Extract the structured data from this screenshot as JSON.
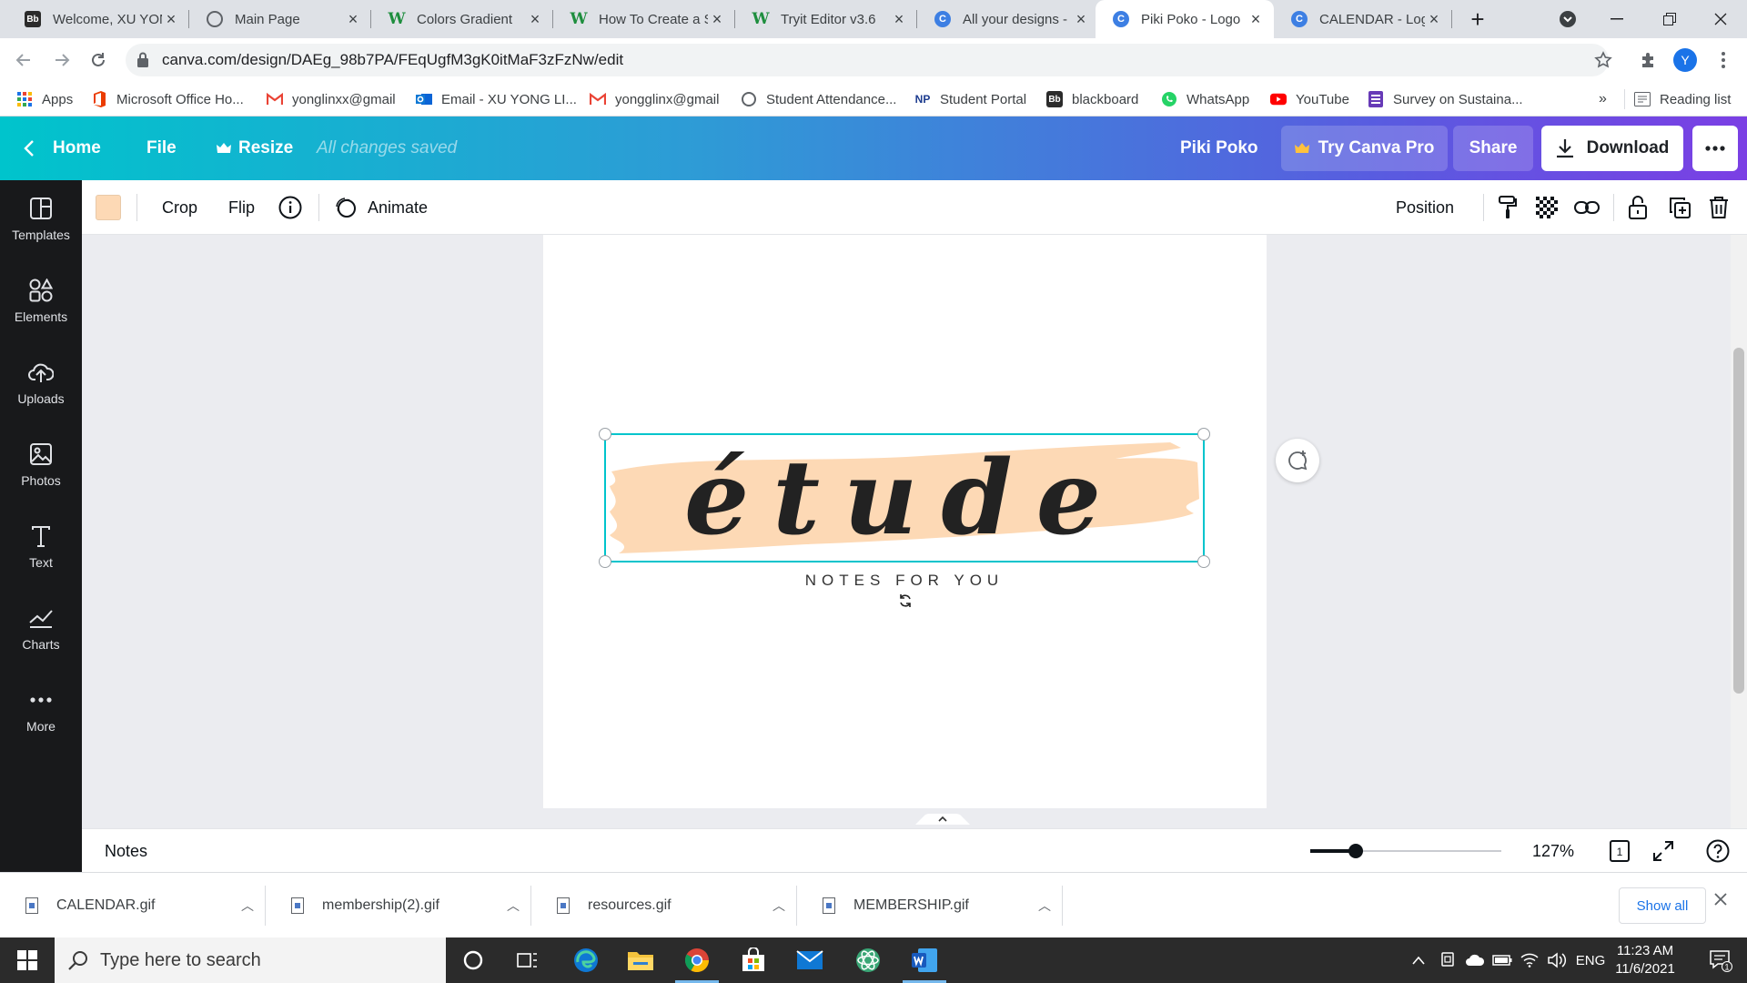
{
  "browser": {
    "tabs": [
      {
        "label": "Welcome, XU YON",
        "icon": "blackboard-icon"
      },
      {
        "label": "Main Page",
        "icon": "globe-icon"
      },
      {
        "label": "Colors Gradient",
        "icon": "w-site-icon"
      },
      {
        "label": "How To Create a S",
        "icon": "w-site-icon"
      },
      {
        "label": "Tryit Editor v3.6",
        "icon": "w-site-icon"
      },
      {
        "label": "All your designs -",
        "icon": "canva-icon"
      },
      {
        "label": "Piki Poko - Logo",
        "icon": "canva-icon",
        "active": true
      },
      {
        "label": "CALENDAR - Logo",
        "icon": "canva-icon"
      }
    ],
    "url": "canva.com/design/DAEg_98b7PA/FEqUgfM3gK0itMaF3zFzNw/edit",
    "profile_initial": "Y",
    "bookmarks": [
      {
        "label": "Apps"
      },
      {
        "label": "Microsoft Office Ho..."
      },
      {
        "label": "yonglinxx@gmail"
      },
      {
        "label": "Email - XU YONG LI..."
      },
      {
        "label": "yongglinx@gmail"
      },
      {
        "label": "Student Attendance..."
      },
      {
        "label": "Student Portal"
      },
      {
        "label": "blackboard"
      },
      {
        "label": "WhatsApp"
      },
      {
        "label": "YouTube"
      },
      {
        "label": "Survey on Sustaina..."
      }
    ],
    "bookmarks_overflow": "»",
    "reading_list": "Reading list"
  },
  "canva": {
    "header": {
      "home": "Home",
      "file": "File",
      "resize": "Resize",
      "saved_status": "All changes saved",
      "design_name": "Piki Poko",
      "try_pro": "Try Canva Pro",
      "share": "Share",
      "download": "Download"
    },
    "sidebar": [
      {
        "label": "Templates"
      },
      {
        "label": "Elements"
      },
      {
        "label": "Uploads"
      },
      {
        "label": "Photos"
      },
      {
        "label": "Text"
      },
      {
        "label": "Charts"
      },
      {
        "label": "More"
      }
    ],
    "toolbar": {
      "swatch_color": "#fdd9b5",
      "crop": "Crop",
      "flip": "Flip",
      "animate": "Animate",
      "position": "Position"
    },
    "canvas": {
      "logo_text": "étude",
      "tagline": "NOTES FOR YOU",
      "brush_color": "#fdd9b5",
      "selection_color": "#00c4cc"
    },
    "footer": {
      "notes": "Notes",
      "zoom_label": "127%",
      "zoom_fraction": 0.24,
      "page_count": "1"
    }
  },
  "downloads": {
    "items": [
      {
        "filename": "CALENDAR.gif"
      },
      {
        "filename": "membership(2).gif"
      },
      {
        "filename": "resources.gif"
      },
      {
        "filename": "MEMBERSHIP.gif"
      }
    ],
    "show_all": "Show all"
  },
  "taskbar": {
    "search_placeholder": "Type here to search",
    "language": "ENG",
    "time": "11:23 AM",
    "date": "11/6/2021",
    "notification_count": "1"
  }
}
